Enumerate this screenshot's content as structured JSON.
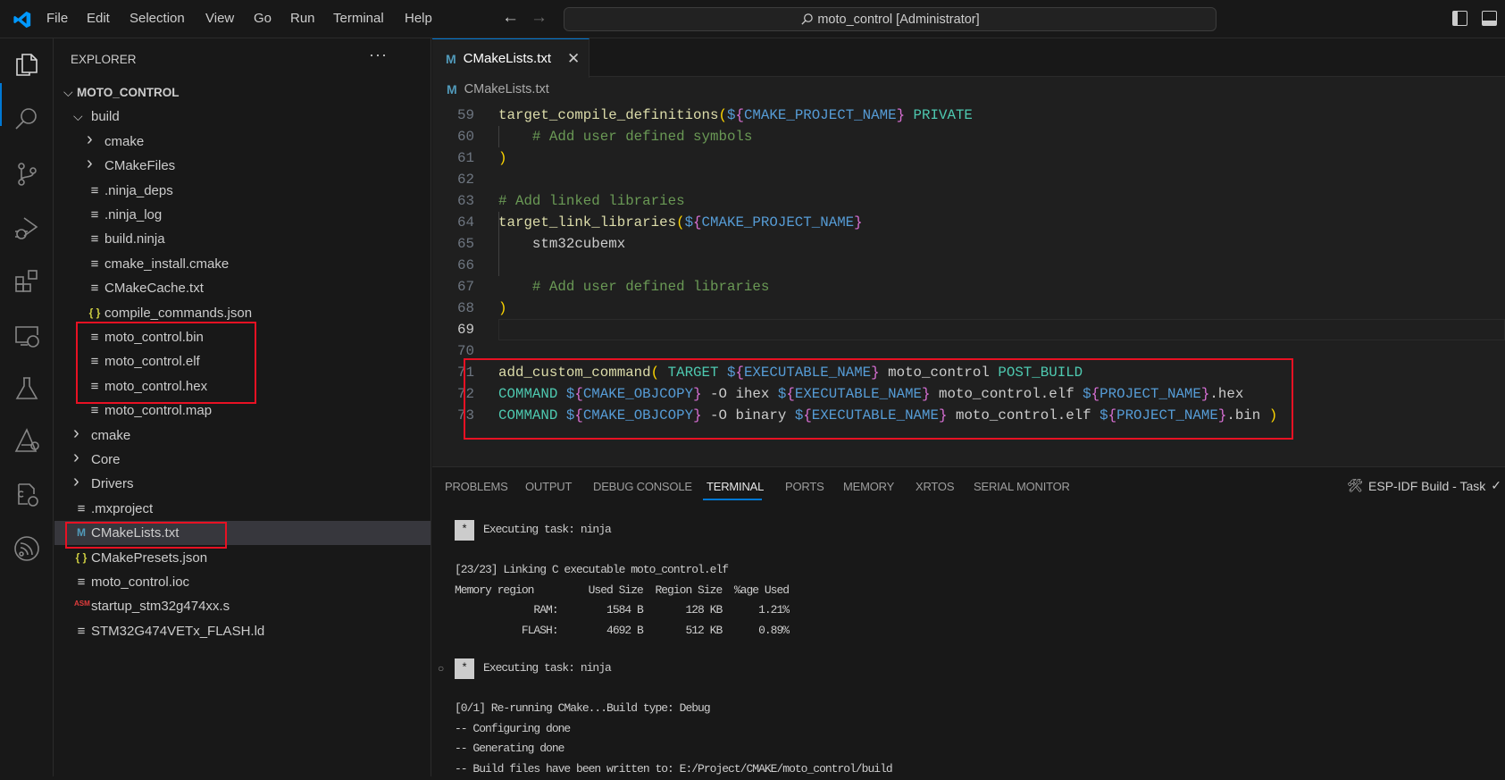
{
  "titlebar": {
    "menu": [
      "File",
      "Edit",
      "Selection",
      "View",
      "Go",
      "Run",
      "Terminal",
      "Help"
    ],
    "command_center": "moto_control [Administrator]",
    "search_icon": "search-icon"
  },
  "activity_bar": [
    "explorer",
    "search",
    "source-control",
    "run-debug",
    "extensions",
    "remote-explorer",
    "testing",
    "stm32",
    "cmake",
    "espressif"
  ],
  "sidebar": {
    "title": "EXPLORER",
    "more": "···",
    "tree": [
      {
        "label": "MOTO_CONTROL",
        "kind": "root",
        "open": true,
        "level": 0
      },
      {
        "label": "build",
        "kind": "folder",
        "open": true,
        "level": 1
      },
      {
        "label": "cmake",
        "kind": "folder",
        "open": false,
        "level": 2
      },
      {
        "label": "CMakeFiles",
        "kind": "folder",
        "open": false,
        "level": 2
      },
      {
        "label": ".ninja_deps",
        "kind": "file",
        "level": 2
      },
      {
        "label": ".ninja_log",
        "kind": "file",
        "level": 2
      },
      {
        "label": "build.ninja",
        "kind": "file",
        "level": 2
      },
      {
        "label": "cmake_install.cmake",
        "kind": "file",
        "level": 2
      },
      {
        "label": "CMakeCache.txt",
        "kind": "file",
        "level": 2
      },
      {
        "label": "compile_commands.json",
        "kind": "json",
        "level": 2
      },
      {
        "label": "moto_control.bin",
        "kind": "file",
        "level": 2
      },
      {
        "label": "moto_control.elf",
        "kind": "file",
        "level": 2
      },
      {
        "label": "moto_control.hex",
        "kind": "file",
        "level": 2
      },
      {
        "label": "moto_control.map",
        "kind": "file",
        "level": 2
      },
      {
        "label": "cmake",
        "kind": "folder",
        "open": false,
        "level": 1
      },
      {
        "label": "Core",
        "kind": "folder",
        "open": false,
        "level": 1
      },
      {
        "label": "Drivers",
        "kind": "folder",
        "open": false,
        "level": 1
      },
      {
        "label": ".mxproject",
        "kind": "file",
        "level": 1
      },
      {
        "label": "CMakeLists.txt",
        "kind": "cmake",
        "level": 1,
        "selected": true
      },
      {
        "label": "CMakePresets.json",
        "kind": "json",
        "level": 1
      },
      {
        "label": "moto_control.ioc",
        "kind": "file",
        "level": 1
      },
      {
        "label": "startup_stm32g474xx.s",
        "kind": "asm",
        "level": 1
      },
      {
        "label": "STM32G474VETx_FLASH.ld",
        "kind": "file",
        "level": 1
      }
    ]
  },
  "editor": {
    "tab_label": "CMakeLists.txt",
    "tab_icon": "M",
    "breadcrumb": "CMakeLists.txt",
    "current_line": 69,
    "lines": [
      {
        "n": 59,
        "tokens": [
          [
            "f",
            "target_compile_definitions"
          ],
          [
            "p",
            "("
          ],
          [
            "d",
            "$"
          ],
          [
            "b",
            "{"
          ],
          [
            "v",
            "CMAKE_PROJECT_NAME"
          ],
          [
            "b",
            "}"
          ],
          [
            "t",
            " "
          ],
          [
            "k",
            "PRIVATE"
          ]
        ]
      },
      {
        "n": 60,
        "tokens": [
          [
            "t",
            "    "
          ],
          [
            "c",
            "# Add user defined symbols"
          ]
        ]
      },
      {
        "n": 61,
        "tokens": [
          [
            "p",
            ")"
          ]
        ]
      },
      {
        "n": 62,
        "tokens": []
      },
      {
        "n": 63,
        "tokens": [
          [
            "c",
            "# Add linked libraries"
          ]
        ]
      },
      {
        "n": 64,
        "tokens": [
          [
            "f",
            "target_link_libraries"
          ],
          [
            "p",
            "("
          ],
          [
            "d",
            "$"
          ],
          [
            "b",
            "{"
          ],
          [
            "v",
            "CMAKE_PROJECT_NAME"
          ],
          [
            "b",
            "}"
          ]
        ]
      },
      {
        "n": 65,
        "tokens": [
          [
            "t",
            "    stm32cubemx"
          ]
        ]
      },
      {
        "n": 66,
        "tokens": []
      },
      {
        "n": 67,
        "tokens": [
          [
            "t",
            "    "
          ],
          [
            "c",
            "# Add user defined libraries"
          ]
        ]
      },
      {
        "n": 68,
        "tokens": [
          [
            "p",
            ")"
          ]
        ]
      },
      {
        "n": 69,
        "tokens": []
      },
      {
        "n": 70,
        "tokens": []
      },
      {
        "n": 71,
        "tokens": [
          [
            "f",
            "add_custom_command"
          ],
          [
            "p",
            "("
          ],
          [
            "t",
            " "
          ],
          [
            "k",
            "TARGET"
          ],
          [
            "t",
            " "
          ],
          [
            "d",
            "$"
          ],
          [
            "b",
            "{"
          ],
          [
            "v",
            "EXECUTABLE_NAME"
          ],
          [
            "b",
            "}"
          ],
          [
            "t",
            " moto_control "
          ],
          [
            "k",
            "POST_BUILD"
          ]
        ]
      },
      {
        "n": 72,
        "tokens": [
          [
            "k",
            "COMMAND"
          ],
          [
            "t",
            " "
          ],
          [
            "d",
            "$"
          ],
          [
            "b",
            "{"
          ],
          [
            "v",
            "CMAKE_OBJCOPY"
          ],
          [
            "b",
            "}"
          ],
          [
            "t",
            " -O ihex "
          ],
          [
            "d",
            "$"
          ],
          [
            "b",
            "{"
          ],
          [
            "v",
            "EXECUTABLE_NAME"
          ],
          [
            "b",
            "}"
          ],
          [
            "t",
            " moto_control.elf "
          ],
          [
            "d",
            "$"
          ],
          [
            "b",
            "{"
          ],
          [
            "v",
            "PROJECT_NAME"
          ],
          [
            "b",
            "}"
          ],
          [
            "t",
            ".hex"
          ]
        ]
      },
      {
        "n": 73,
        "tokens": [
          [
            "k",
            "COMMAND"
          ],
          [
            "t",
            " "
          ],
          [
            "d",
            "$"
          ],
          [
            "b",
            "{"
          ],
          [
            "v",
            "CMAKE_OBJCOPY"
          ],
          [
            "b",
            "}"
          ],
          [
            "t",
            " -O binary "
          ],
          [
            "d",
            "$"
          ],
          [
            "b",
            "{"
          ],
          [
            "v",
            "EXECUTABLE_NAME"
          ],
          [
            "b",
            "}"
          ],
          [
            "t",
            " moto_control.elf "
          ],
          [
            "d",
            "$"
          ],
          [
            "b",
            "{"
          ],
          [
            "v",
            "PROJECT_NAME"
          ],
          [
            "b",
            "}"
          ],
          [
            "t",
            ".bin "
          ],
          [
            "p",
            ")"
          ]
        ]
      }
    ]
  },
  "panel": {
    "tabs": [
      "PROBLEMS",
      "OUTPUT",
      "DEBUG CONSOLE",
      "TERMINAL",
      "PORTS",
      "MEMORY",
      "XRTOS",
      "SERIAL MONITOR"
    ],
    "active_tab": "TERMINAL",
    "task_label": "ESP-IDF Build - Task",
    "task_status": "✓",
    "terminal": [
      {
        "star": true,
        "text": "Executing task: ninja"
      },
      {
        "text": ""
      },
      {
        "text": "[23/23] Linking C executable moto_control.elf"
      },
      {
        "text": "Memory region         Used Size  Region Size  %age Used"
      },
      {
        "text": "             RAM:        1584 B       128 KB      1.21%"
      },
      {
        "text": "           FLASH:        4692 B       512 KB      0.89%"
      },
      {
        "text": ""
      },
      {
        "star": true,
        "dot": true,
        "text": "Executing task: ninja"
      },
      {
        "text": ""
      },
      {
        "text": "[0/1] Re-running CMake...Build type: Debug"
      },
      {
        "text": "-- Configuring done"
      },
      {
        "text": "-- Generating done"
      },
      {
        "text": "-- Build files have been written to: E:/Project/CMAKE/moto_control/build"
      }
    ]
  },
  "colors": {
    "accent": "#0078d4",
    "highlight_box": "#e81123",
    "selected_row": "#37373d"
  }
}
